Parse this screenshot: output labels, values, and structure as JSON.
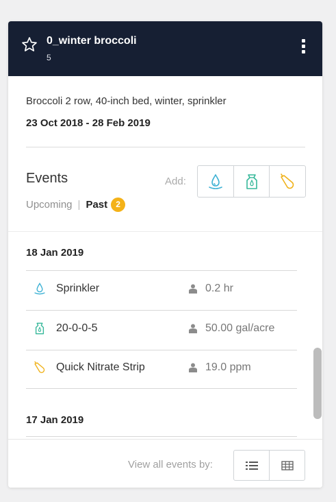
{
  "planting": {
    "name": "0_winter broccoli",
    "count": "5",
    "description": "Broccoli 2 row, 40-inch bed, winter, sprinkler",
    "date_range": "23 Oct 2018 - 28 Feb 2019"
  },
  "events": {
    "title": "Events",
    "add_label": "Add:",
    "add_buttons": [
      "water-drop-icon",
      "fertilizer-bag-icon",
      "soil-sample-icon"
    ],
    "filter": {
      "upcoming": "Upcoming",
      "separator": "|",
      "past": "Past",
      "past_count": "2"
    }
  },
  "event_groups": [
    {
      "date": "18 Jan 2019",
      "items": [
        {
          "icon": "water-drop-icon",
          "name": "Sprinkler",
          "value": "0.2 hr"
        },
        {
          "icon": "fertilizer-bag-icon",
          "name": "20-0-0-5",
          "value": "50.00 gal/acre"
        },
        {
          "icon": "soil-sample-icon",
          "name": "Quick Nitrate Strip",
          "value": "19.0 ppm"
        }
      ]
    },
    {
      "date": "17 Jan 2019",
      "items": []
    }
  ],
  "footer": {
    "view_label": "View all events by:",
    "view_buttons": [
      "list-view-icon",
      "table-view-icon"
    ]
  },
  "colors": {
    "header_bg": "#161f33",
    "water": "#3cb1d4",
    "fertilizer": "#36b89a",
    "soil": "#f0b21b",
    "badge": "#f4b218"
  }
}
